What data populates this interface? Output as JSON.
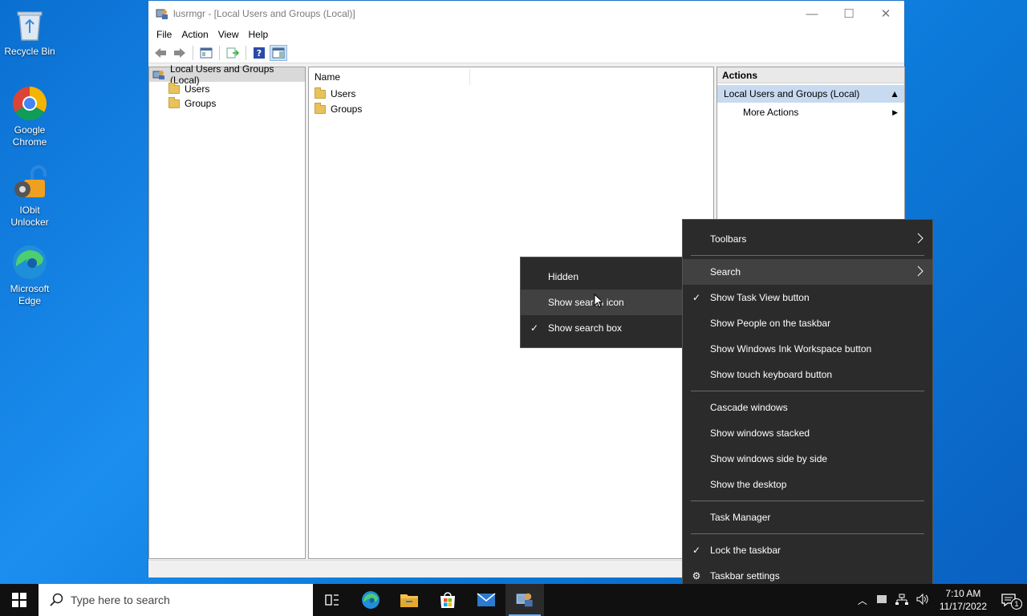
{
  "desktop": {
    "icons": [
      {
        "label": "Recycle Bin"
      },
      {
        "label": "Google Chrome"
      },
      {
        "label": "IObit Unlocker"
      },
      {
        "label": "Microsoft Edge"
      }
    ]
  },
  "window": {
    "title": "lusrmgr - [Local Users and Groups (Local)]",
    "menu": [
      "File",
      "Action",
      "View",
      "Help"
    ],
    "tree": {
      "root": "Local Users and Groups (Local)",
      "children": [
        "Users",
        "Groups"
      ]
    },
    "list": {
      "column": "Name",
      "items": [
        "Users",
        "Groups"
      ]
    },
    "actions": {
      "header": "Actions",
      "section": "Local Users and Groups (Local)",
      "more": "More Actions"
    }
  },
  "context_menu": {
    "items": [
      {
        "label": "Toolbars",
        "submenu": true
      },
      {
        "label": "Search",
        "submenu": true,
        "highlighted": true
      },
      {
        "label": "Show Task View button",
        "checked": true
      },
      {
        "label": "Show People on the taskbar"
      },
      {
        "label": "Show Windows Ink Workspace button"
      },
      {
        "label": "Show touch keyboard button"
      },
      {
        "label": "Cascade windows"
      },
      {
        "label": "Show windows stacked"
      },
      {
        "label": "Show windows side by side"
      },
      {
        "label": "Show the desktop"
      },
      {
        "label": "Task Manager"
      },
      {
        "label": "Lock the taskbar",
        "checked": true
      },
      {
        "label": "Taskbar settings",
        "gear": true
      }
    ]
  },
  "search_submenu": {
    "items": [
      {
        "label": "Hidden"
      },
      {
        "label": "Show search icon",
        "highlighted": true
      },
      {
        "label": "Show search box",
        "checked": true
      }
    ]
  },
  "taskbar": {
    "search_placeholder": "Type here to search",
    "time": "7:10 AM",
    "date": "11/17/2022",
    "notification_count": "1"
  }
}
